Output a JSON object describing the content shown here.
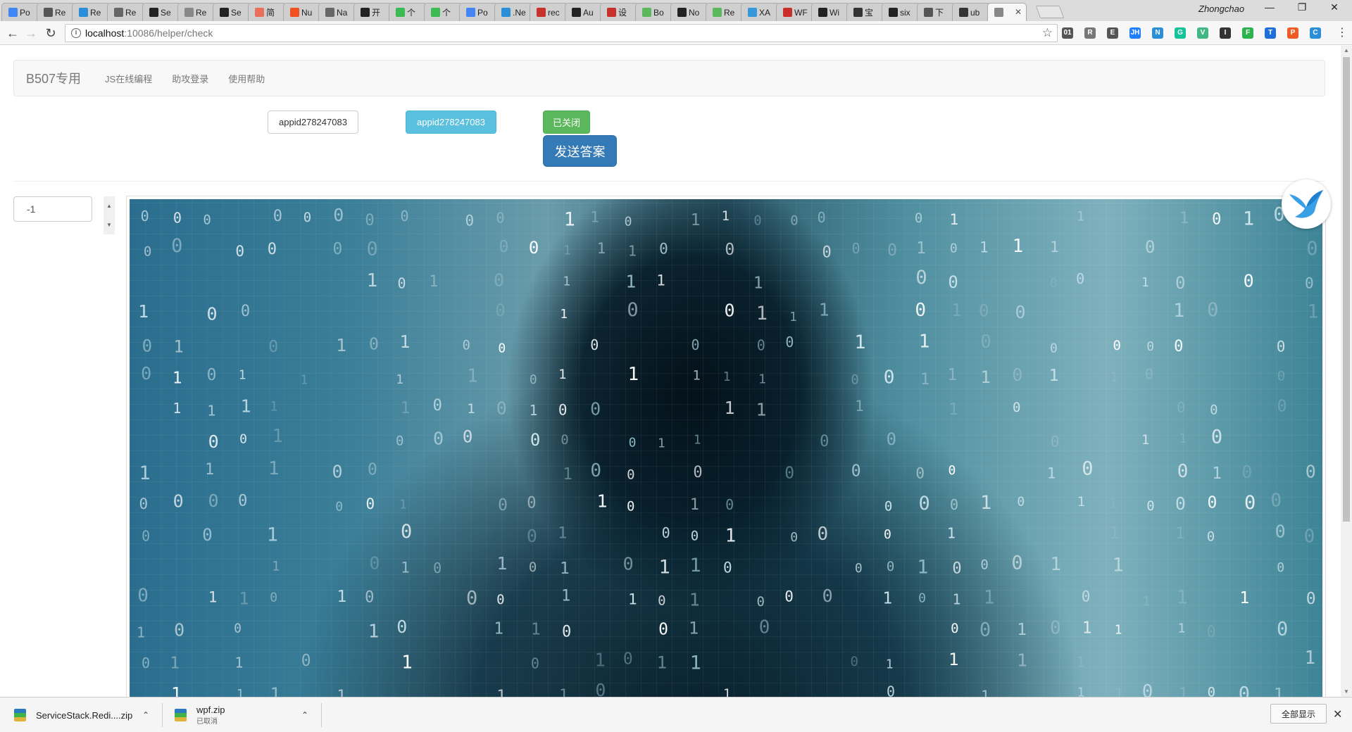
{
  "browser": {
    "tabs": [
      {
        "label": "Po",
        "icon": "google-icon",
        "color": "#4285f4"
      },
      {
        "label": "Re",
        "icon": "gamepad-icon",
        "color": "#555555"
      },
      {
        "label": "Re",
        "icon": "cloud-icon",
        "color": "#2a8fd8"
      },
      {
        "label": "Re",
        "icon": "flag-icon",
        "color": "#666666"
      },
      {
        "label": "Se",
        "icon": "github-icon",
        "color": "#222222"
      },
      {
        "label": "Re",
        "icon": "page-icon",
        "color": "#888888"
      },
      {
        "label": "Se",
        "icon": "github-icon",
        "color": "#222222"
      },
      {
        "label": "简",
        "icon": "jianshu-icon",
        "color": "#ea6f5a"
      },
      {
        "label": "Nu",
        "icon": "microsoft-icon",
        "color": "#f25022"
      },
      {
        "label": "Na",
        "icon": "flag-icon",
        "color": "#666666"
      },
      {
        "label": "开",
        "icon": "github-icon",
        "color": "#222222"
      },
      {
        "label": "个",
        "icon": "play-icon",
        "color": "#3cba54"
      },
      {
        "label": "个",
        "icon": "play-icon",
        "color": "#3cba54"
      },
      {
        "label": "Po",
        "icon": "google-icon",
        "color": "#4285f4"
      },
      {
        "label": ".Ne",
        "icon": "cloud-icon",
        "color": "#2a8fd8"
      },
      {
        "label": "rec",
        "icon": "csdn-icon",
        "color": "#c9302c"
      },
      {
        "label": "Au",
        "icon": "github-icon",
        "color": "#222222"
      },
      {
        "label": "设",
        "icon": "csdn-icon",
        "color": "#c9302c"
      },
      {
        "label": "Bo",
        "icon": "android-icon",
        "color": "#5cb85c"
      },
      {
        "label": "No",
        "icon": "github-icon",
        "color": "#222222"
      },
      {
        "label": "Re",
        "icon": "android-icon",
        "color": "#5cb85c"
      },
      {
        "label": "XA",
        "icon": "xamarin-icon",
        "color": "#3498db"
      },
      {
        "label": "WF",
        "icon": "csdn-icon",
        "color": "#c9302c"
      },
      {
        "label": "Wi",
        "icon": "github-icon",
        "color": "#222222"
      },
      {
        "label": "宝",
        "icon": "bt-icon",
        "color": "#333333"
      },
      {
        "label": "six",
        "icon": "github-icon",
        "color": "#222222"
      },
      {
        "label": "下",
        "icon": "download-icon",
        "color": "#555555"
      },
      {
        "label": "ub",
        "icon": "terminal-icon",
        "color": "#333333"
      },
      {
        "label": "",
        "icon": "page-icon",
        "color": "#888888",
        "active": true
      }
    ],
    "profile_name": "Zhongchao",
    "url_host": "localhost",
    "url_path": ":10086/helper/check",
    "extensions": [
      {
        "icon": "01-extension-icon",
        "color": "#555555",
        "glyph": "01"
      },
      {
        "icon": "r-extension-icon",
        "color": "#777777",
        "glyph": "R"
      },
      {
        "icon": "evernote-icon",
        "color": "#555555",
        "glyph": "E"
      },
      {
        "icon": "juejin-icon",
        "color": "#1e80ff",
        "glyph": "JH"
      },
      {
        "icon": "notes-icon",
        "color": "#2a8fd8",
        "glyph": "N"
      },
      {
        "icon": "grammarly-icon",
        "color": "#15c39a",
        "glyph": "G"
      },
      {
        "icon": "vue-devtools-icon",
        "color": "#41b883",
        "glyph": "V"
      },
      {
        "icon": "incognito-icon",
        "color": "#333333",
        "glyph": "I"
      },
      {
        "icon": "feedly-icon",
        "color": "#2bb24c",
        "glyph": "F"
      },
      {
        "icon": "translate-icon",
        "color": "#1e6fd9",
        "glyph": "T"
      },
      {
        "icon": "postman-icon",
        "color": "#ef5b25",
        "glyph": "P"
      },
      {
        "icon": "cast-icon",
        "color": "#2a8fd8",
        "glyph": "C"
      }
    ]
  },
  "page": {
    "brand": "B507专用",
    "nav": [
      "JS在线编程",
      "助攻登录",
      "使用帮助"
    ],
    "appid_input_value": "appid278247083",
    "appid_button_label": "appid278247083",
    "status_button_label": "已关闭",
    "send_button_label": "发送答案",
    "number_input_value": "-1"
  },
  "downloads": [
    {
      "name": "ServiceStack.Redi....zip",
      "status": ""
    },
    {
      "name": "wpf.zip",
      "status": "已取消"
    }
  ],
  "show_all_label": "全部显示"
}
